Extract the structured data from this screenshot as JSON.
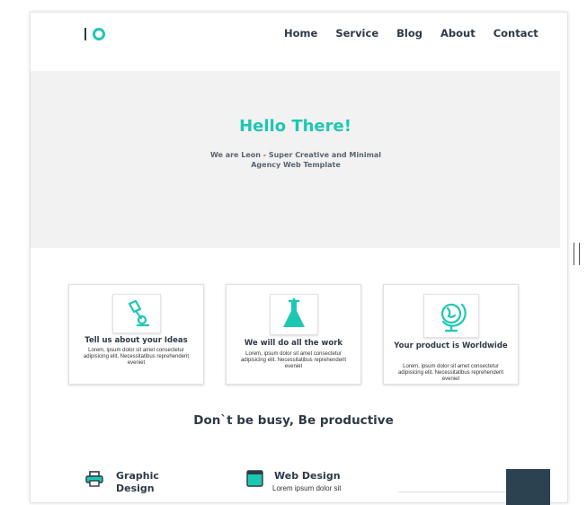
{
  "nav": {
    "items": [
      "Home",
      "Service",
      "Blog",
      "About",
      "Contact"
    ]
  },
  "hero": {
    "title": "Hello There!",
    "subtitle_line1": "We are Leon - Super Creative and Minimal",
    "subtitle_line2": "Agency Web Template"
  },
  "cards": [
    {
      "icon": "desk-lamp-icon",
      "title": "Tell us about your Ideas",
      "text": "Lorem, ipsum dolor sit amet consectetur adipisicing elit. Necessitatibus reprehenderit eveniet"
    },
    {
      "icon": "flask-icon",
      "title": "We will do all the work",
      "text": "Lorem, ipsum dolor sit amet consectetur adipisicing elit. Necessitatibus reprehenderit eveniet"
    },
    {
      "icon": "globe-icon",
      "title": "Your product is Worldwide",
      "text": "Lorem, ipsum dolor sit amet consectetur adipisicing elit. Necessitatibus reprehenderit eveniet"
    }
  ],
  "section": {
    "title": "Don`t be busy, Be productive"
  },
  "services": [
    {
      "icon": "printer-icon",
      "title_line1": "Graphic",
      "title_line2": "Design"
    },
    {
      "icon": "browser-window-icon",
      "title": "Web Design",
      "text": "Lorem ipsum dolor sit"
    }
  ],
  "colors": {
    "accent": "#1dc8b3",
    "dark": "#2e3a46",
    "hero_bg": "#f2f2f2",
    "dark_block": "#2d4250"
  }
}
